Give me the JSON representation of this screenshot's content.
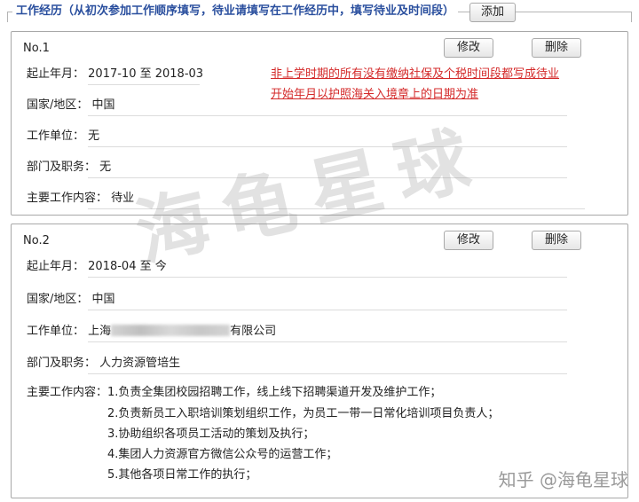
{
  "section": {
    "title": "工作经历（从初次参加工作顺序填写，待业请填写在工作经历中，填写待业及时间段）",
    "add_label": "添加"
  },
  "buttons": {
    "edit": "修改",
    "delete": "删除"
  },
  "labels": {
    "period": "起止年月：",
    "country": "国家/地区：",
    "employer": "工作单位：",
    "department": "部门及职务：",
    "duties": "主要工作内容："
  },
  "entries": [
    {
      "no": "No.1",
      "period": "2017-10 至 2018-03",
      "country": "中国",
      "employer": "无",
      "department": "无",
      "duties": "待业"
    },
    {
      "no": "No.2",
      "period": "2018-04 至 今",
      "country": "中国",
      "employer_prefix": "上海",
      "employer_suffix": "有限公司",
      "department": "人力资源管培生",
      "duties": [
        "1.负责全集团校园招聘工作，线上线下招聘渠道开发及维护工作；",
        "2.负责新员工入职培训策划组织工作，为员工一带一日常化培训项目负责人；",
        "3.协助组织各项员工活动的策划及执行；",
        "4.集团人力资源官方微信公众号的运营工作；",
        "5.其他各项日常工作的执行；"
      ]
    }
  ],
  "annotation": [
    "非上学时期的所有没有缴纳社保及个税时间段都写成待业",
    "开始年月以护照海关入境章上的日期为准"
  ],
  "watermark": {
    "big": "海龟星球",
    "small": "知乎 @海龟星球"
  },
  "colors": {
    "title_blue": "#2a4f9e",
    "annotation_red": "#d42a2a"
  }
}
